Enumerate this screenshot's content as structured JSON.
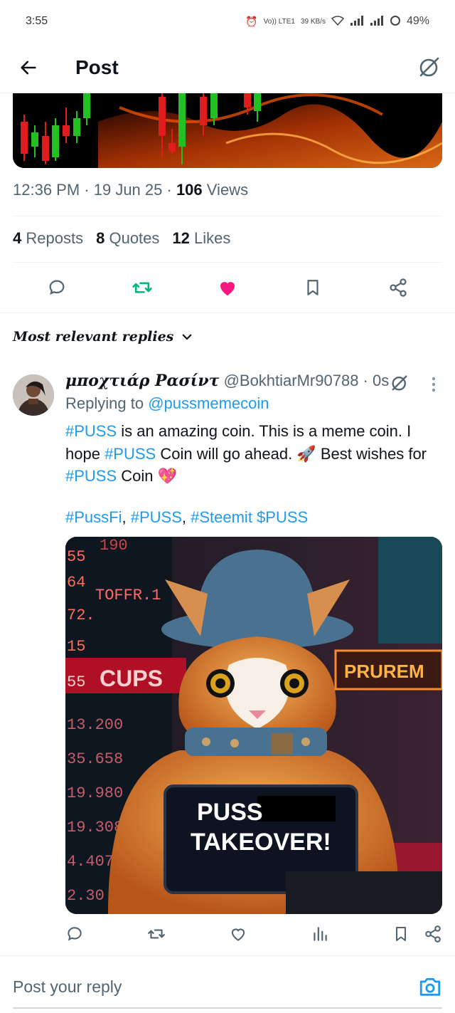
{
  "status_bar": {
    "time": "3:55",
    "net_label": "Vo)) LTE1",
    "speed": "39 KB/s",
    "battery": "49%"
  },
  "header": {
    "title": "Post"
  },
  "post": {
    "time": "12:36 PM",
    "date": "19 Jun 25",
    "views_count": "106",
    "views_label": "Views",
    "reposts_count": "4",
    "reposts_label": "Reposts",
    "quotes_count": "8",
    "quotes_label": "Quotes",
    "likes_count": "12",
    "likes_label": "Likes"
  },
  "replies_sort": {
    "label": "Most relevant replies"
  },
  "reply": {
    "name": "μποχτιάρ Ρασίντ",
    "handle": "@BokhtiarMr90788",
    "sep": " · ",
    "time": "0s",
    "replying_prefix": "Replying to",
    "replying_to": "@pussmemecoin",
    "line1_tag": "#PUSS",
    "line1_text": " is an amazing coin. This is a meme coin. I hope ",
    "line1_tag2": "#PUSS",
    "line1_text2": " Coin will go ahead. 🚀 Best wishes for ",
    "line1_tag3": "#PUSS",
    "line1_text3": " Coin 💖",
    "tag_a": "#PussFi",
    "tag_b": "#PUSS",
    "tag_c": "#Steemit",
    "tag_d": "$PUSS",
    "comma": ", "
  },
  "reply_image": {
    "sign_line1": "PUSS",
    "sign_line2": "TAKEOVER!",
    "neon_sign": "PRUREM",
    "board_word": "CUPS",
    "board_word2": "TOFFR.1",
    "board_numbers": [
      "190",
      "55",
      "64",
      "72.",
      "15",
      "55",
      "13.200",
      "35.658",
      "19.980",
      "19.308",
      "4.407",
      "2.30"
    ]
  },
  "composer": {
    "placeholder": "Post your reply"
  },
  "colors": {
    "accent": "#1d9bf0",
    "like": "#f91880",
    "repost": "#00ba7c"
  }
}
